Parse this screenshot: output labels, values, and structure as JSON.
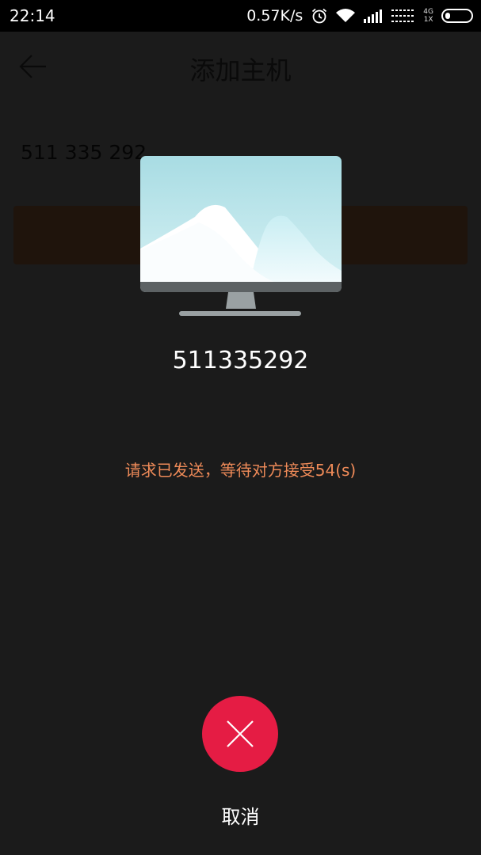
{
  "status_bar": {
    "time": "22:14",
    "net_speed": "0.57K/s",
    "network_type_top": "4G",
    "network_type_bottom": "1X",
    "icons": [
      "alarm-icon",
      "wifi-icon",
      "signal-icon",
      "signal-icon-2",
      "battery-icon"
    ],
    "battery_level": 0.2
  },
  "background_page": {
    "title": "添加主机",
    "host_id": "511 335 292"
  },
  "dialog": {
    "host_number": "511335292",
    "message": "请求已发送，等待对方接受54(s)",
    "cancel_label": "取消",
    "cancel_color": "#e51c44",
    "message_color": "#ee8a58"
  }
}
